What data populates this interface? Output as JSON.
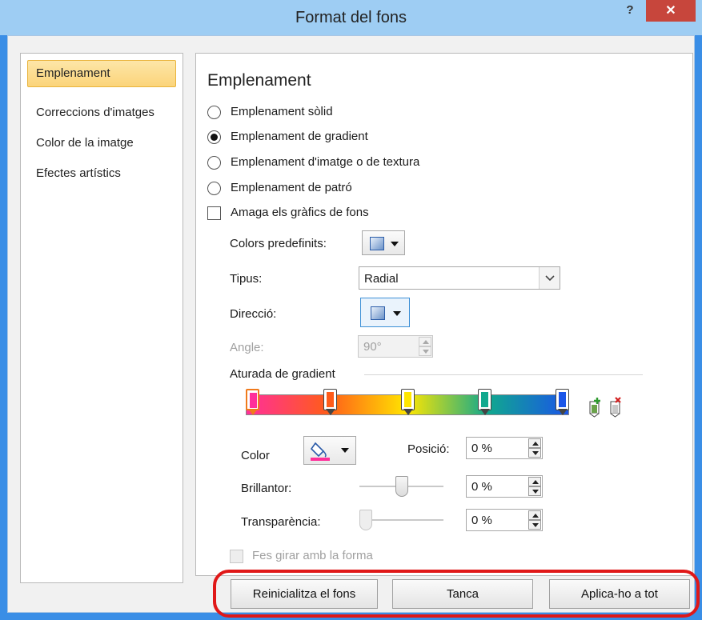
{
  "dialog": {
    "title": "Format del fons",
    "help_label": "?",
    "close_label": "✕"
  },
  "sidebar": {
    "items": [
      {
        "label": "Emplenament",
        "active": true
      },
      {
        "label": "Correccions d'imatges"
      },
      {
        "label": "Color de la imatge"
      },
      {
        "label": "Efectes artístics"
      }
    ]
  },
  "fill": {
    "heading": "Emplenament",
    "options": [
      {
        "label": "Emplenament sòlid",
        "selected": false
      },
      {
        "label": "Emplenament de gradient",
        "selected": true
      },
      {
        "label": "Emplenament d'imatge o de textura",
        "selected": false
      },
      {
        "label": "Emplenament de patró",
        "selected": false
      }
    ],
    "hide_graphics_label": "Amaga els gràfics de fons"
  },
  "gradient": {
    "preset_label": "Colors predefinits:",
    "type_label": "Tipus:",
    "type_value": "Radial",
    "direction_label": "Direcció:",
    "angle_label": "Angle:",
    "angle_value": "90°",
    "stops_label": "Aturada de gradient",
    "stops": [
      {
        "position": 0,
        "color": "#ff2f9a",
        "active": true
      },
      {
        "position": 25,
        "color": "#ff5c1a"
      },
      {
        "position": 50,
        "color": "#ffe600"
      },
      {
        "position": 75,
        "color": "#10a88e"
      },
      {
        "position": 100,
        "color": "#1a55e8"
      }
    ],
    "color_label": "Color",
    "color_value": "#ff2f9a",
    "position_label": "Posició:",
    "position_value": "0 %",
    "brightness_label": "Brillantor:",
    "brightness_value": "0 %",
    "brightness_level": 0.5,
    "transparency_label": "Transparència:",
    "transparency_value": "0 %",
    "transparency_level": 0.0,
    "rotate_label": "Fes girar amb la forma"
  },
  "buttons": {
    "reset": "Reinicialitza el fons",
    "close": "Tanca",
    "apply_all": "Aplica-ho a tot"
  },
  "colors": {
    "accent": "#3a8ee6",
    "highlight_ring": "#e01818",
    "active_tab": "#fbd47a"
  }
}
